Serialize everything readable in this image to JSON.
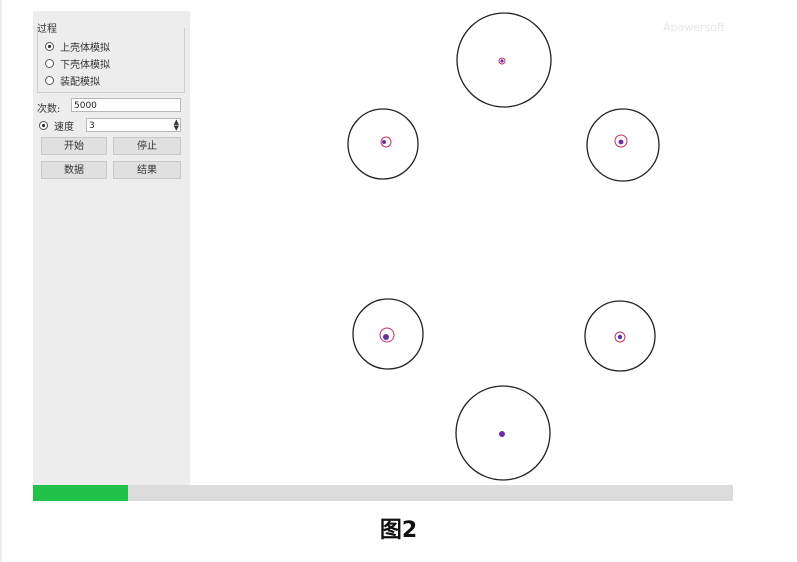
{
  "sidebar": {
    "group_title": "过程",
    "radios": [
      {
        "label": "上壳体模拟",
        "checked": true
      },
      {
        "label": "下壳体模拟",
        "checked": false
      },
      {
        "label": "装配模拟",
        "checked": false
      }
    ],
    "count_label": "次数:",
    "count_value": "5000",
    "speed_label": "速度",
    "speed_value": "3",
    "speed_checked": true,
    "buttons": {
      "start": "开始",
      "stop": "停止",
      "data": "数据",
      "result": "结果"
    }
  },
  "canvas": {
    "watermark": "Apowersoft"
  },
  "progress": {
    "fraction": 0.135,
    "color": "#22c24a"
  },
  "caption": "图2",
  "colors": {
    "circle_stroke": "#222222",
    "orbit_stroke": "#c0306a",
    "marker_fill": "#6a2fa0"
  }
}
